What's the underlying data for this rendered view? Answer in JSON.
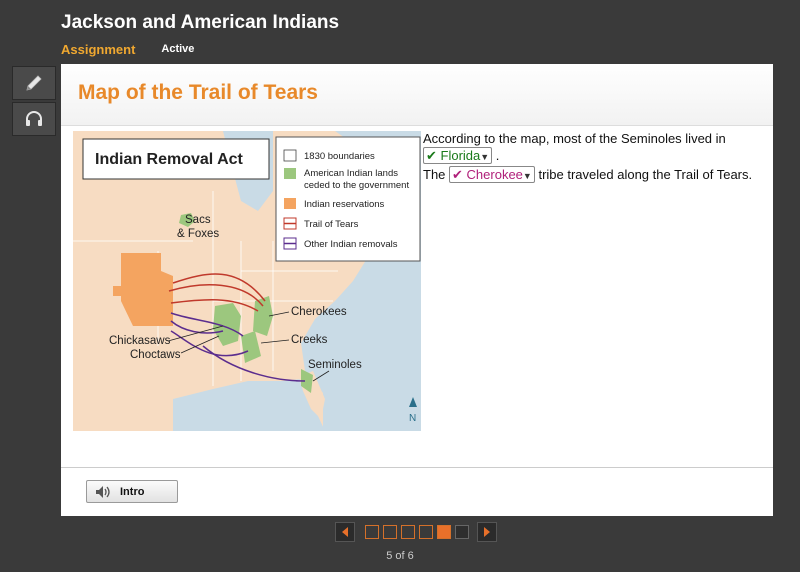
{
  "header": {
    "title": "Jackson and American Indians",
    "section": "Assignment",
    "status": "Active"
  },
  "tools": [
    {
      "name": "pencil-icon"
    },
    {
      "name": "headphones-icon"
    }
  ],
  "card": {
    "title": "Map of the Trail of Tears"
  },
  "map": {
    "title": "Indian Removal Act",
    "legend": [
      "1830 boundaries",
      "American Indian lands",
      "ceded to the government",
      "Indian reservations",
      "Trail of Tears",
      "Other Indian removals"
    ],
    "labels": {
      "sacs": "Sacs",
      "foxes": "& Foxes",
      "cherokees": "Cherokees",
      "creeks": "Creeks",
      "chickasaws": "Chickasaws",
      "choctaws": "Choctaws",
      "seminoles": "Seminoles",
      "north": "N"
    },
    "colors": {
      "land": "#f7dcc2",
      "water": "#c9dbe6",
      "ceded": "#9cc77e",
      "reservation": "#f4a460",
      "trail": "#c0392b",
      "other": "#5b2d8e"
    }
  },
  "questions": {
    "q1_text": "According to the map, most of the Seminoles lived in",
    "q1_answer": "✔ Florida",
    "q1_end": ".",
    "q2_start": "The",
    "q2_answer": "✔ Cherokee",
    "q2_end": "tribe traveled along the Trail of Tears."
  },
  "footer": {
    "intro_label": "Intro",
    "page_count": "5 of 6",
    "current_page": 5,
    "total_pages": 6
  }
}
